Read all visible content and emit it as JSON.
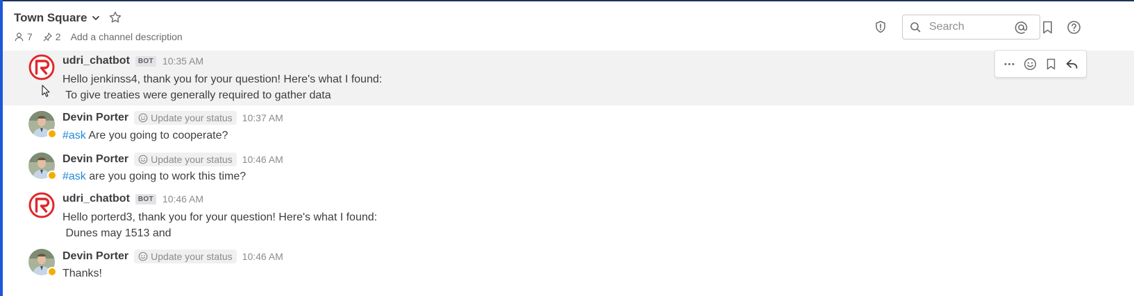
{
  "header": {
    "channel_name": "Town Square",
    "member_count": "7",
    "pinned_count": "2",
    "description_placeholder": "Add a channel description",
    "search_placeholder": "Search"
  },
  "posts": [
    {
      "author": "udri_chatbot",
      "badge": "BOT",
      "time": "10:35 AM",
      "line1": "Hello jenkinss4, thank you for your question! Here's what I found:",
      "line2": " To give treaties were generally required to gather data"
    },
    {
      "author": "Devin Porter",
      "status": "Update your status",
      "time": "10:37 AM",
      "hashtag": "#ask",
      "text": " Are you going to cooperate?"
    },
    {
      "author": "Devin Porter",
      "status": "Update your status",
      "time": "10:46 AM",
      "hashtag": "#ask",
      "text": " are you going to work this time?"
    },
    {
      "author": "udri_chatbot",
      "badge": "BOT",
      "time": "10:46 AM",
      "line1": "Hello porterd3, thank you for your question! Here's what I found:",
      "line2": " Dunes may 1513 and"
    },
    {
      "author": "Devin Porter",
      "status": "Update your status",
      "time": "10:46 AM",
      "text": "Thanks!"
    }
  ],
  "colors": {
    "accent": "#1c58d9",
    "link": "#2389d7",
    "away": "#f5ab00",
    "bot_red": "#e0262b"
  },
  "icons": [
    "chevron-down-icon",
    "star-icon",
    "member-icon",
    "pin-icon",
    "shield-icon",
    "search-icon",
    "at-mention-icon",
    "bookmark-icon",
    "help-icon",
    "more-icon",
    "emoji-icon",
    "reply-icon"
  ]
}
